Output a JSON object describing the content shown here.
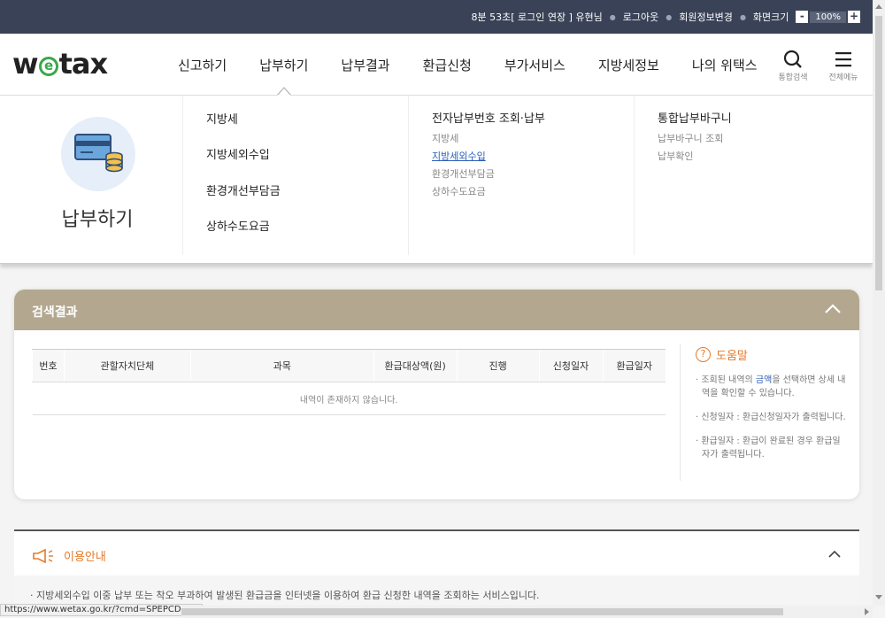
{
  "topbar": {
    "session": "8분 53초[ 로그인 연장 ] 유현님",
    "logout": "로그아웃",
    "member_edit": "회원정보변경",
    "screen_size": "화면크기",
    "zoom_minus": "-",
    "zoom_value": "100%",
    "zoom_plus": "+"
  },
  "header": {
    "logo_pre": "w",
    "logo_e": "e",
    "logo_post": "tax",
    "nav": [
      "신고하기",
      "납부하기",
      "납부결과",
      "환급신청",
      "부가서비스",
      "지방세정보",
      "나의 위택스"
    ],
    "search_label": "통합검색",
    "menu_label": "전체메뉴"
  },
  "dropdown": {
    "title": "납부하기",
    "col1": [
      "지방세",
      "지방세외수입",
      "환경개선부담금",
      "상하수도요금"
    ],
    "col2_head": "전자납부번호 조회·납부",
    "col2_items": [
      "지방세",
      "지방세외수입",
      "환경개선부담금",
      "상하수도요금"
    ],
    "col3_head": "통합납부바구니",
    "col3_items": [
      "납부바구니 조회",
      "납부확인"
    ]
  },
  "result": {
    "title": "검색결과",
    "columns": [
      "번호",
      "관할자치단체",
      "과목",
      "환급대상액(원)",
      "진행",
      "신청일자",
      "환급일자"
    ],
    "empty": "내역이 존재하지 않습니다.",
    "help_title": "도움말",
    "help_1a": "· 조회된 내역의 ",
    "help_1b": "금액",
    "help_1c": "을 선택하면 상세 내역을 확인할 수 있습니다.",
    "help_2": "· 신청일자 : 환급신청일자가 출력됩니다.",
    "help_3": "· 환급일자 : 환급이 완료된 경우 환급일자가 출력됩니다."
  },
  "guide": {
    "title": "이용안내",
    "text": "· 지방세외수입 이중 납부 또는 착오 부과하여 발생된 환급금을 인터넷을 이용하여 환급 신청한 내역을 조회하는 서비스입니다."
  },
  "status_url": "https://www.wetax.go.kr/?cmd=SPEPCD0R0",
  "colors": {
    "topbar": "#3a4257",
    "result_bar": "#b3a78f",
    "accent_orange": "#e57a2a",
    "logo_green": "#3aa84a",
    "link_blue": "#2b5fb8"
  }
}
